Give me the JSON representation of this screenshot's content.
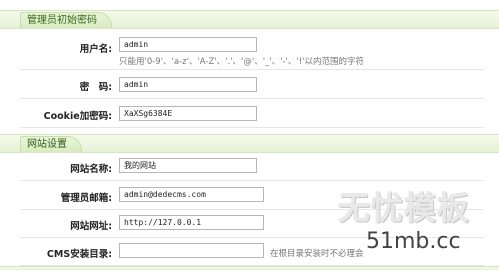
{
  "section1": {
    "title": "管理员初始密码",
    "fields": {
      "username": {
        "label": "用户名:",
        "value": "admin",
        "hint": "只能用'0-9'、'a-z'、'A-Z'、'.'、'@'、'_'、'-'、'!'以内范围的字符"
      },
      "password": {
        "label": "密　码:",
        "value": "admin"
      },
      "cookie": {
        "label": "Cookie加密码:",
        "value": "XaXSg6384E"
      }
    }
  },
  "section2": {
    "title": "网站设置",
    "fields": {
      "sitename": {
        "label": "网站名称:",
        "value": "我的网站"
      },
      "adminemail": {
        "label": "管理员邮箱:",
        "value": "admin@dedecms.com"
      },
      "siteurl": {
        "label": "网站网址:",
        "value": "http://127.0.0.1"
      },
      "cmsdir": {
        "label": "CMS安装目录:",
        "value": "",
        "hint": "在根目录安装时不必理会"
      }
    }
  },
  "watermark": {
    "title": "无忧模板",
    "url": "51mb.cc"
  }
}
